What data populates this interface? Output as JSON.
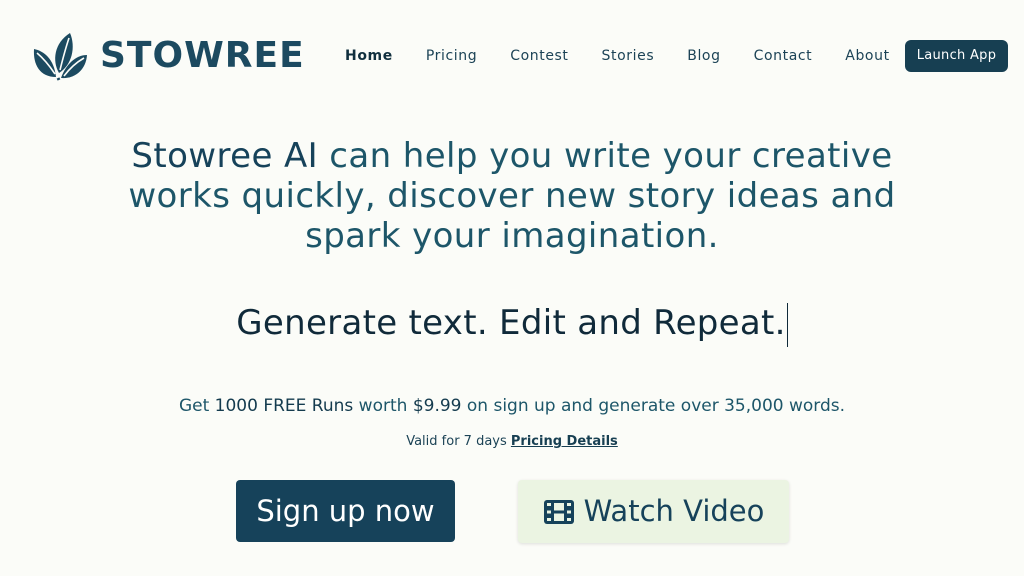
{
  "brand": {
    "name": "STOWREE",
    "logo_icon": "leaf-logo-icon"
  },
  "nav": {
    "items": [
      {
        "label": "Home",
        "active": true
      },
      {
        "label": "Pricing"
      },
      {
        "label": "Contest"
      },
      {
        "label": "Stories"
      },
      {
        "label": "Blog"
      },
      {
        "label": "Contact"
      },
      {
        "label": "About"
      }
    ],
    "launch_label": "Launch App"
  },
  "hero": {
    "brand_phrase": "Stowree AI",
    "heading_rest": " can help you write your creative works quickly, discover new story ideas and spark your imagination.",
    "typed_text": "Generate text. Edit and Repeat."
  },
  "offer": {
    "prefix": "Get ",
    "runs": "1000 FREE Runs",
    "middle": " worth ",
    "price": "$9.99",
    "suffix": " on sign up and generate over 35,000 words."
  },
  "validity": {
    "text": "Valid for 7 days",
    "link_label": "Pricing Details"
  },
  "cta": {
    "signup_label": "Sign up now",
    "video_label": "Watch Video",
    "video_icon": "film-icon"
  },
  "colors": {
    "primary": "#16425a",
    "background": "#fbfcf8",
    "video_button_bg": "#ebf4e2"
  }
}
